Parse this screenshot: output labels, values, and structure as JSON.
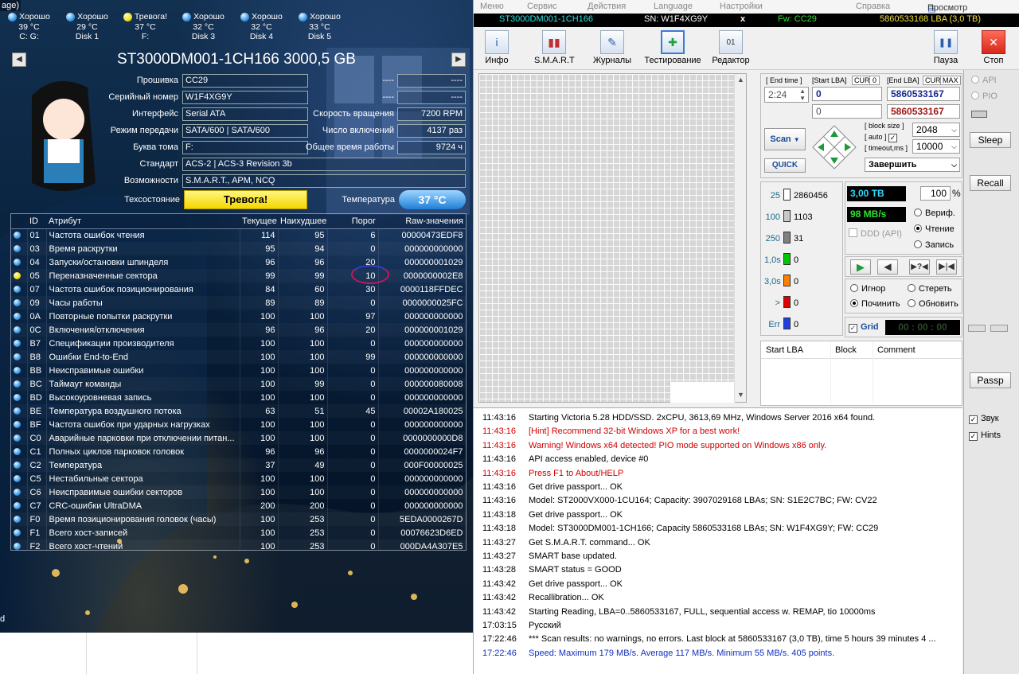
{
  "crop_note": "age)",
  "disks": [
    {
      "status": "Хорошо",
      "temp": "39 °C",
      "label": "C: G:",
      "warn": false
    },
    {
      "status": "Хорошо",
      "temp": "29 °C",
      "label": "Disk 1",
      "warn": false
    },
    {
      "status": "Тревога!",
      "temp": "37 °C",
      "label": "F:",
      "warn": true
    },
    {
      "status": "Хорошо",
      "temp": "32 °C",
      "label": "Disk 3",
      "warn": false
    },
    {
      "status": "Хорошо",
      "temp": "32 °C",
      "label": "Disk 4",
      "warn": false
    },
    {
      "status": "Хорошо",
      "temp": "33 °C",
      "label": "Disk 5",
      "warn": false
    }
  ],
  "cdi": {
    "prev_icon": "left-arrow-icon",
    "next_icon": "right-arrow-icon",
    "model_title": "ST3000DM001-1CH166 3000,5 GB",
    "firmware_label": "Прошивка",
    "firmware": "CC29",
    "serial_label": "Серийный номер",
    "serial": "W1F4XG9Y",
    "interface_label": "Интерфейс",
    "interface": "Serial ATA",
    "transfer_label": "Режим передачи",
    "transfer": "SATA/600 | SATA/600",
    "letter_label": "Буква тома",
    "letter": "F:",
    "standard_label": "Стандарт",
    "standard": "ACS-2 | ACS-3 Revision 3b",
    "features_label": "Возможности",
    "features": "S.M.A.R.T., APM, NCQ",
    "health_label": "Техсостояние",
    "health": "Тревога!",
    "blank1": "----",
    "blank2": "----",
    "blank3": "----",
    "blank4": "----",
    "rpm_label": "Скорость вращения",
    "rpm": "7200 RPM",
    "power_count_label": "Число включений",
    "power_count": "4137 раз",
    "power_hours_label": "Общее время работы",
    "power_hours": "9724 ч",
    "temp_label": "Температура",
    "temp": "37 °C",
    "headers": [
      "ID",
      "Атрибут",
      "Текущее",
      "Наихудшее",
      "Порог",
      "Raw-значения"
    ],
    "rows": [
      {
        "id": "01",
        "name": "Частота ошибок чтения",
        "cur": "114",
        "worst": "95",
        "thr": "6",
        "raw": "00000473EDF8",
        "warn": false
      },
      {
        "id": "03",
        "name": "Время раскрутки",
        "cur": "95",
        "worst": "94",
        "thr": "0",
        "raw": "000000000000",
        "warn": false
      },
      {
        "id": "04",
        "name": "Запуски/остановки шпинделя",
        "cur": "96",
        "worst": "96",
        "thr": "20",
        "raw": "000000001029",
        "warn": false
      },
      {
        "id": "05",
        "name": "Переназначенные сектора",
        "cur": "99",
        "worst": "99",
        "thr": "10",
        "raw": "0000000002E8",
        "warn": true
      },
      {
        "id": "07",
        "name": "Частота ошибок позиционирования",
        "cur": "84",
        "worst": "60",
        "thr": "30",
        "raw": "0000118FFDEC",
        "warn": false
      },
      {
        "id": "09",
        "name": "Часы работы",
        "cur": "89",
        "worst": "89",
        "thr": "0",
        "raw": "0000000025FC",
        "warn": false
      },
      {
        "id": "0A",
        "name": "Повторные попытки раскрутки",
        "cur": "100",
        "worst": "100",
        "thr": "97",
        "raw": "000000000000",
        "warn": false
      },
      {
        "id": "0C",
        "name": "Включения/отключения",
        "cur": "96",
        "worst": "96",
        "thr": "20",
        "raw": "000000001029",
        "warn": false
      },
      {
        "id": "B7",
        "name": "Спецификации производителя",
        "cur": "100",
        "worst": "100",
        "thr": "0",
        "raw": "000000000000",
        "warn": false
      },
      {
        "id": "B8",
        "name": "Ошибки End-to-End",
        "cur": "100",
        "worst": "100",
        "thr": "99",
        "raw": "000000000000",
        "warn": false
      },
      {
        "id": "BB",
        "name": "Неисправимые ошибки",
        "cur": "100",
        "worst": "100",
        "thr": "0",
        "raw": "000000000000",
        "warn": false
      },
      {
        "id": "BC",
        "name": "Таймаут команды",
        "cur": "100",
        "worst": "99",
        "thr": "0",
        "raw": "000000080008",
        "warn": false
      },
      {
        "id": "BD",
        "name": "Высокоуровневая запись",
        "cur": "100",
        "worst": "100",
        "thr": "0",
        "raw": "000000000000",
        "warn": false
      },
      {
        "id": "BE",
        "name": "Температура воздушного потока",
        "cur": "63",
        "worst": "51",
        "thr": "45",
        "raw": "00002A180025",
        "warn": false
      },
      {
        "id": "BF",
        "name": "Частота ошибок при ударных нагрузках",
        "cur": "100",
        "worst": "100",
        "thr": "0",
        "raw": "000000000000",
        "warn": false
      },
      {
        "id": "C0",
        "name": "Аварийные парковки при отключении питан...",
        "cur": "100",
        "worst": "100",
        "thr": "0",
        "raw": "0000000000D8",
        "warn": false
      },
      {
        "id": "C1",
        "name": "Полных циклов парковок головок",
        "cur": "96",
        "worst": "96",
        "thr": "0",
        "raw": "0000000024F7",
        "warn": false
      },
      {
        "id": "C2",
        "name": "Температура",
        "cur": "37",
        "worst": "49",
        "thr": "0",
        "raw": "000F00000025",
        "warn": false
      },
      {
        "id": "C5",
        "name": "Нестабильные сектора",
        "cur": "100",
        "worst": "100",
        "thr": "0",
        "raw": "000000000000",
        "warn": false
      },
      {
        "id": "C6",
        "name": "Неисправимые ошибки секторов",
        "cur": "100",
        "worst": "100",
        "thr": "0",
        "raw": "000000000000",
        "warn": false
      },
      {
        "id": "C7",
        "name": "CRC-ошибки UltraDMA",
        "cur": "200",
        "worst": "200",
        "thr": "0",
        "raw": "000000000000",
        "warn": false
      },
      {
        "id": "F0",
        "name": "Время позиционирования головок (часы)",
        "cur": "100",
        "worst": "253",
        "thr": "0",
        "raw": "5EDA0000267D",
        "warn": false
      },
      {
        "id": "F1",
        "name": "Всего хост-записей",
        "cur": "100",
        "worst": "253",
        "thr": "0",
        "raw": "00076623D6ED",
        "warn": false
      },
      {
        "id": "F2",
        "name": "Всего хост-чтений",
        "cur": "100",
        "worst": "253",
        "thr": "0",
        "raw": "000DA4A307E5",
        "warn": false
      }
    ]
  },
  "victoria": {
    "menu": [
      "Меню",
      "Сервис",
      "Действия",
      "Language",
      "Настройки",
      "Справка",
      "Просмотр буфера"
    ],
    "buffer_icon": "buffer-view-icon",
    "model": "ST3000DM001-1CH166",
    "sn": "SN: W1F4XG9Y",
    "close": "x",
    "fw": "Fw: CC29",
    "lba": "5860533168 LBA (3,0 TB)",
    "toolbar": [
      {
        "label": "Инфо",
        "icon": "info-icon",
        "glyph": "i"
      },
      {
        "label": "S.M.A.R.T",
        "icon": "smart-chart-icon",
        "glyph": "▮▮"
      },
      {
        "label": "Журналы",
        "icon": "logs-folder-icon",
        "glyph": "✎"
      },
      {
        "label": "Тестирование",
        "icon": "test-plus-icon",
        "glyph": "✚"
      },
      {
        "label": "Редактор",
        "icon": "hex-editor-icon",
        "glyph": "01"
      }
    ],
    "pause_label": "Пауза",
    "stop_label": "Стоп",
    "end_time_label": "[ End time ]",
    "end_time": "2:24",
    "start_lba_label": "[Start LBA]",
    "cur_label": "CUR",
    "zero_label": "0",
    "end_lba_label": "[End LBA]",
    "max_label": "MAX",
    "start_lba": "0",
    "end_lba": "5860533167",
    "start_lba2": "0",
    "end_lba2": "5860533167",
    "scan_label": "Scan",
    "quick_label": "QUICK",
    "block_size_label": "[ block size ]",
    "auto_label": "[ auto ]",
    "block_size": "2048",
    "timeout_label": "[ timeout,ms ]",
    "timeout": "10000",
    "finish_action": "Завершить",
    "counters": [
      {
        "label": "25",
        "value": "2860456",
        "color": "#ffffff"
      },
      {
        "label": "100",
        "value": "1103",
        "color": "#c8c8c8"
      },
      {
        "label": "250",
        "value": "31",
        "color": "#808080"
      },
      {
        "label": "1,0s",
        "value": "0",
        "color": "#00c800"
      },
      {
        "label": "3,0s",
        "value": "0",
        "color": "#ff8000"
      },
      {
        "label": ">",
        "value": "0",
        "color": "#e00000"
      },
      {
        "label": "Err",
        "value": "0",
        "color": "#2040e0"
      }
    ],
    "progress_size": "3,00 TB",
    "progress_pct": "100",
    "pct_sign": "%",
    "speed": "98 MB/s",
    "ddd_label": "DDD (API)",
    "verify_label": "Вериф.",
    "read_label": "Чтение",
    "write_label": "Запись",
    "ignore_label": "Игнор",
    "erase_label": "Стереть",
    "repair_label": "Починить",
    "refresh_label": "Обновить",
    "grid_label": "Grid",
    "timer": "00 : 00 : 00",
    "table_headers": [
      "Start LBA",
      "Block",
      "Comment"
    ],
    "api_label": "API",
    "pio_label": "PIO",
    "sleep_label": "Sleep",
    "recall_label": "Recall",
    "passp_label": "Passp",
    "sound_label": "Звук",
    "hints_label": "Hints",
    "log": [
      {
        "t": "11:43:16",
        "m": "Starting Victoria 5.28 HDD/SSD. 2xCPU, 3613,69 MHz, Windows Server 2016 x64 found.",
        "c": "#000000"
      },
      {
        "t": "11:43:16",
        "m": "[Hint] Recommend 32-bit Windows XP for a best work!",
        "c": "#d00000"
      },
      {
        "t": "11:43:16",
        "m": "Warning! Windows x64 detected! PIO mode supported on Windows x86 only.",
        "c": "#d00000"
      },
      {
        "t": "11:43:16",
        "m": "API access enabled, device #0",
        "c": "#000000"
      },
      {
        "t": "11:43:16",
        "m": "Press F1 to About/HELP",
        "c": "#d00000"
      },
      {
        "t": "11:43:16",
        "m": "Get drive passport... OK",
        "c": "#000000"
      },
      {
        "t": "11:43:16",
        "m": "Model: ST2000VX000-1CU164; Capacity: 3907029168 LBAs; SN: S1E2C7BC; FW: CV22",
        "c": "#000000"
      },
      {
        "t": "11:43:18",
        "m": "Get drive passport... OK",
        "c": "#000000"
      },
      {
        "t": "11:43:18",
        "m": "Model: ST3000DM001-1CH166; Capacity 5860533168 LBAs; SN: W1F4XG9Y; FW: CC29",
        "c": "#000000"
      },
      {
        "t": "11:43:27",
        "m": "Get S.M.A.R.T. command... OK",
        "c": "#000000"
      },
      {
        "t": "11:43:27",
        "m": "SMART base updated.",
        "c": "#000000"
      },
      {
        "t": "11:43:28",
        "m": "SMART status = GOOD",
        "c": "#000000"
      },
      {
        "t": "11:43:42",
        "m": "Get drive passport... OK",
        "c": "#000000"
      },
      {
        "t": "11:43:42",
        "m": "Recallibration... OK",
        "c": "#000000"
      },
      {
        "t": "11:43:42",
        "m": "Starting Reading, LBA=0..5860533167, FULL, sequential access w. REMAP, tio 10000ms",
        "c": "#000000"
      },
      {
        "t": "17:03:15",
        "m": "Русский",
        "c": "#000000"
      },
      {
        "t": "17:22:46",
        "m": "*** Scan results: no warnings, no errors. Last block at 5860533167 (3,0 TB), time 5 hours 39 minutes 4 ...",
        "c": "#000000"
      },
      {
        "t": "17:22:46",
        "m": "Speed: Maximum 179 MB/s. Average 117 MB/s. Minimum 55 MB/s. 405 points.",
        "c": "#1030c0"
      }
    ],
    "cropped_letter": "d"
  }
}
